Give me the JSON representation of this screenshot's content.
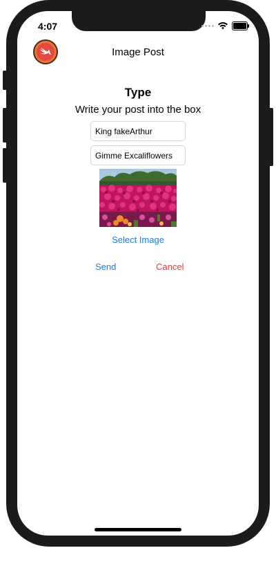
{
  "status_bar": {
    "time": "4:07"
  },
  "nav": {
    "title": "Image Post",
    "app_icon": "swift-bird-icon"
  },
  "form": {
    "heading": "Type",
    "subtitle": "Write your post into the box",
    "title_field_value": "King fakeArthur",
    "body_field_value": "Gimme Excaliflowers",
    "photo_icon": "flower-photo",
    "select_image_label": "Select Image"
  },
  "actions": {
    "send_label": "Send",
    "cancel_label": "Cancel"
  },
  "colors": {
    "link_blue": "#1a7cf0",
    "cancel_red": "#f2372e",
    "icon_orange": "#e8753a"
  }
}
